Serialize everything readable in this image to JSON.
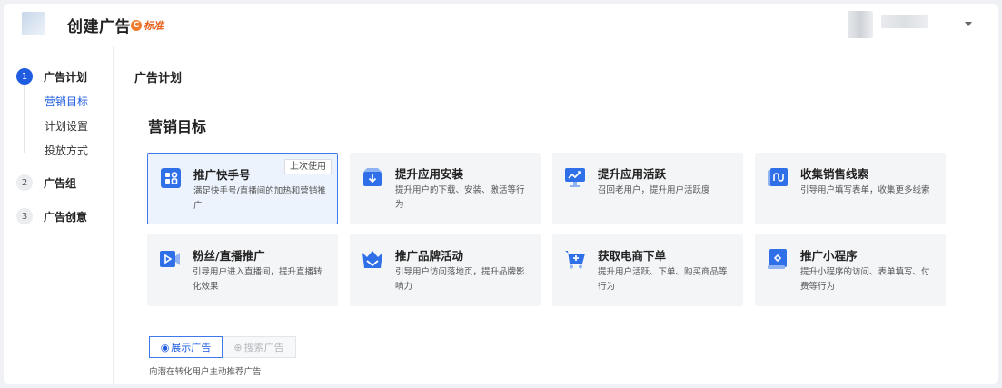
{
  "header": {
    "title": "创建广告",
    "badge_icon": "C",
    "badge_label": "标准",
    "accent": "#1f5ce0"
  },
  "sidebar": {
    "steps": [
      {
        "num": "1",
        "label": "广告计划"
      },
      {
        "num": "2",
        "label": "广告组"
      },
      {
        "num": "3",
        "label": "广告创意"
      }
    ],
    "sub_items": [
      "营销目标",
      "计划设置",
      "投放方式"
    ]
  },
  "main": {
    "section_title": "广告计划",
    "goal_title": "营销目标",
    "last_used": "上次使用",
    "cards": [
      {
        "title": "推广快手号",
        "desc": "满足快手号/直播间的加热和营销推广",
        "icon": "app-grid-icon"
      },
      {
        "title": "提升应用安装",
        "desc": "提升用户的下载、安装、激活等行为",
        "icon": "download-box-icon"
      },
      {
        "title": "提升应用活跃",
        "desc": "召回老用户，提升用户活跃度",
        "icon": "trend-screen-icon"
      },
      {
        "title": "收集销售线索",
        "desc": "引导用户填写表单，收集更多线索",
        "icon": "wave-folder-icon"
      },
      {
        "title": "粉丝/直播推广",
        "desc": "引导用户进入直播间，提升直播转化效果",
        "icon": "video-camera-icon"
      },
      {
        "title": "推广品牌活动",
        "desc": "引导用户访问落地页，提升品牌影响力",
        "icon": "crown-icon"
      },
      {
        "title": "获取电商下单",
        "desc": "提升用户活跃、下单、购买商品等行为",
        "icon": "shopping-cart-icon"
      },
      {
        "title": "推广小程序",
        "desc": "提升小程序的访问、表单填写、付费等行为",
        "icon": "mini-program-icon"
      }
    ],
    "tabs": [
      {
        "label": "展示广告"
      },
      {
        "label": "搜索广告"
      }
    ],
    "tab_hint": "向潜在转化用户主动推荐广告"
  }
}
